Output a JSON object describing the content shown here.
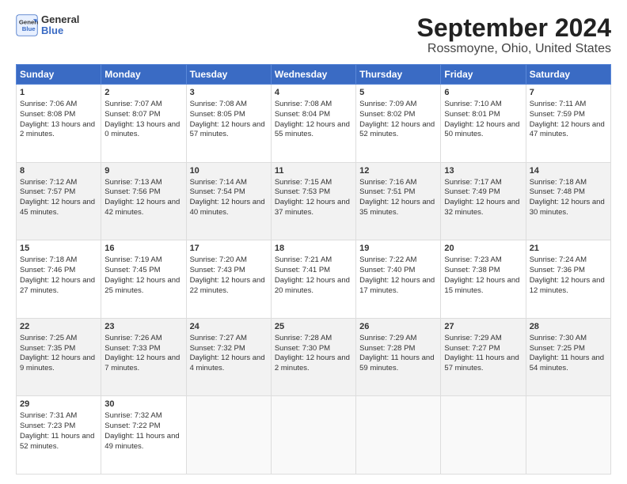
{
  "logo": {
    "line1": "General",
    "line2": "Blue"
  },
  "title": "September 2024",
  "subtitle": "Rossmoyne, Ohio, United States",
  "headers": [
    "Sunday",
    "Monday",
    "Tuesday",
    "Wednesday",
    "Thursday",
    "Friday",
    "Saturday"
  ],
  "weeks": [
    [
      {
        "day": "1",
        "sunrise": "7:06 AM",
        "sunset": "8:08 PM",
        "daylight": "13 hours and 2 minutes."
      },
      {
        "day": "2",
        "sunrise": "7:07 AM",
        "sunset": "8:07 PM",
        "daylight": "13 hours and 0 minutes."
      },
      {
        "day": "3",
        "sunrise": "7:08 AM",
        "sunset": "8:05 PM",
        "daylight": "12 hours and 57 minutes."
      },
      {
        "day": "4",
        "sunrise": "7:08 AM",
        "sunset": "8:04 PM",
        "daylight": "12 hours and 55 minutes."
      },
      {
        "day": "5",
        "sunrise": "7:09 AM",
        "sunset": "8:02 PM",
        "daylight": "12 hours and 52 minutes."
      },
      {
        "day": "6",
        "sunrise": "7:10 AM",
        "sunset": "8:01 PM",
        "daylight": "12 hours and 50 minutes."
      },
      {
        "day": "7",
        "sunrise": "7:11 AM",
        "sunset": "7:59 PM",
        "daylight": "12 hours and 47 minutes."
      }
    ],
    [
      {
        "day": "8",
        "sunrise": "7:12 AM",
        "sunset": "7:57 PM",
        "daylight": "12 hours and 45 minutes."
      },
      {
        "day": "9",
        "sunrise": "7:13 AM",
        "sunset": "7:56 PM",
        "daylight": "12 hours and 42 minutes."
      },
      {
        "day": "10",
        "sunrise": "7:14 AM",
        "sunset": "7:54 PM",
        "daylight": "12 hours and 40 minutes."
      },
      {
        "day": "11",
        "sunrise": "7:15 AM",
        "sunset": "7:53 PM",
        "daylight": "12 hours and 37 minutes."
      },
      {
        "day": "12",
        "sunrise": "7:16 AM",
        "sunset": "7:51 PM",
        "daylight": "12 hours and 35 minutes."
      },
      {
        "day": "13",
        "sunrise": "7:17 AM",
        "sunset": "7:49 PM",
        "daylight": "12 hours and 32 minutes."
      },
      {
        "day": "14",
        "sunrise": "7:18 AM",
        "sunset": "7:48 PM",
        "daylight": "12 hours and 30 minutes."
      }
    ],
    [
      {
        "day": "15",
        "sunrise": "7:18 AM",
        "sunset": "7:46 PM",
        "daylight": "12 hours and 27 minutes."
      },
      {
        "day": "16",
        "sunrise": "7:19 AM",
        "sunset": "7:45 PM",
        "daylight": "12 hours and 25 minutes."
      },
      {
        "day": "17",
        "sunrise": "7:20 AM",
        "sunset": "7:43 PM",
        "daylight": "12 hours and 22 minutes."
      },
      {
        "day": "18",
        "sunrise": "7:21 AM",
        "sunset": "7:41 PM",
        "daylight": "12 hours and 20 minutes."
      },
      {
        "day": "19",
        "sunrise": "7:22 AM",
        "sunset": "7:40 PM",
        "daylight": "12 hours and 17 minutes."
      },
      {
        "day": "20",
        "sunrise": "7:23 AM",
        "sunset": "7:38 PM",
        "daylight": "12 hours and 15 minutes."
      },
      {
        "day": "21",
        "sunrise": "7:24 AM",
        "sunset": "7:36 PM",
        "daylight": "12 hours and 12 minutes."
      }
    ],
    [
      {
        "day": "22",
        "sunrise": "7:25 AM",
        "sunset": "7:35 PM",
        "daylight": "12 hours and 9 minutes."
      },
      {
        "day": "23",
        "sunrise": "7:26 AM",
        "sunset": "7:33 PM",
        "daylight": "12 hours and 7 minutes."
      },
      {
        "day": "24",
        "sunrise": "7:27 AM",
        "sunset": "7:32 PM",
        "daylight": "12 hours and 4 minutes."
      },
      {
        "day": "25",
        "sunrise": "7:28 AM",
        "sunset": "7:30 PM",
        "daylight": "12 hours and 2 minutes."
      },
      {
        "day": "26",
        "sunrise": "7:29 AM",
        "sunset": "7:28 PM",
        "daylight": "11 hours and 59 minutes."
      },
      {
        "day": "27",
        "sunrise": "7:29 AM",
        "sunset": "7:27 PM",
        "daylight": "11 hours and 57 minutes."
      },
      {
        "day": "28",
        "sunrise": "7:30 AM",
        "sunset": "7:25 PM",
        "daylight": "11 hours and 54 minutes."
      }
    ],
    [
      {
        "day": "29",
        "sunrise": "7:31 AM",
        "sunset": "7:23 PM",
        "daylight": "11 hours and 52 minutes."
      },
      {
        "day": "30",
        "sunrise": "7:32 AM",
        "sunset": "7:22 PM",
        "daylight": "11 hours and 49 minutes."
      },
      null,
      null,
      null,
      null,
      null
    ]
  ],
  "daylight_label": "Daylight:"
}
